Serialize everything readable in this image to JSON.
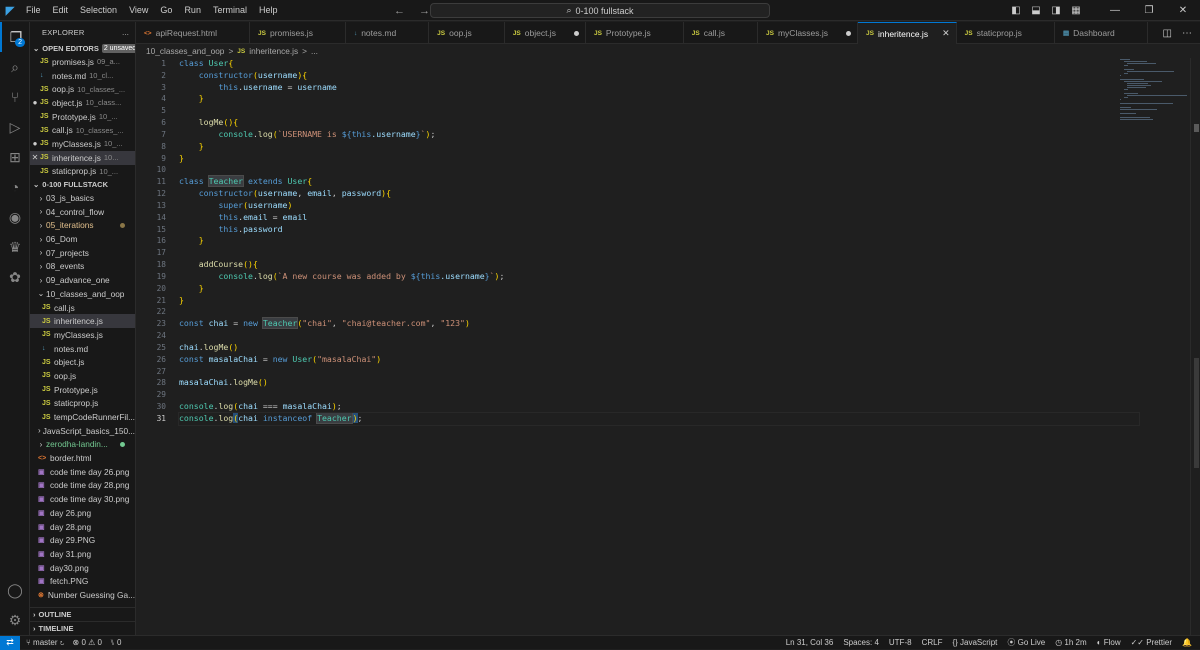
{
  "titlebar": {
    "menu": [
      "File",
      "Edit",
      "Selection",
      "View",
      "Go",
      "Run",
      "Terminal",
      "Help"
    ],
    "search": "0-100 fullstack"
  },
  "activity": {
    "source_control_badge": "2"
  },
  "explorer": {
    "title": "EXPLORER",
    "more": "...",
    "open_editors_label": "OPEN EDITORS",
    "unsaved_label": "2 unsaved",
    "open_editors": [
      {
        "name": "promises.js",
        "path": "09_a...",
        "icon": "JS"
      },
      {
        "name": "notes.md",
        "path": "10_cl...",
        "icon": "↓"
      },
      {
        "name": "oop.js",
        "path": "10_classes_...",
        "icon": "JS"
      },
      {
        "name": "object.js",
        "path": "10_class...",
        "icon": "JS",
        "mark": "●"
      },
      {
        "name": "Prototype.js",
        "path": "10_...",
        "icon": "JS"
      },
      {
        "name": "call.js",
        "path": "10_classes_...",
        "icon": "JS"
      },
      {
        "name": "myClasses.js",
        "path": "10_...",
        "icon": "JS",
        "mark": "●"
      },
      {
        "name": "inheritence.js",
        "path": "10...",
        "icon": "JS",
        "mark": "✕"
      },
      {
        "name": "staticprop.js",
        "path": "10_...",
        "icon": "JS"
      }
    ],
    "workspace_label": "0-100 FULLSTACK",
    "folders_top": [
      "03_js_basics",
      "04_control_flow",
      "05_iterations",
      "06_Dom",
      "07_projects",
      "08_events",
      "09_advance_one",
      "10_classes_and_oop"
    ],
    "folder_files": [
      {
        "name": "call.js",
        "icon": "JS"
      },
      {
        "name": "inheritence.js",
        "icon": "JS"
      },
      {
        "name": "myClasses.js",
        "icon": "JS"
      },
      {
        "name": "notes.md",
        "icon": "↓"
      },
      {
        "name": "object.js",
        "icon": "JS"
      },
      {
        "name": "oop.js",
        "icon": "JS"
      },
      {
        "name": "Prototype.js",
        "icon": "JS"
      },
      {
        "name": "staticprop.js",
        "icon": "JS"
      },
      {
        "name": "tempCodeRunnerFil...",
        "icon": "JS"
      }
    ],
    "folders_bottom": [
      "JavaScript_basics_150...",
      "zerodha-landin..."
    ],
    "root_files": [
      {
        "name": "border.html",
        "icon": "<>"
      },
      {
        "name": "code time day 26.png",
        "icon": "▣"
      },
      {
        "name": "code time day 28.png",
        "icon": "▣"
      },
      {
        "name": "code time day 30.png",
        "icon": "▣"
      },
      {
        "name": "day 26.png",
        "icon": "▣"
      },
      {
        "name": "day 28.png",
        "icon": "▣"
      },
      {
        "name": "day 29.PNG",
        "icon": "▣"
      },
      {
        "name": "day 31.png",
        "icon": "▣"
      },
      {
        "name": "day30.png",
        "icon": "▣"
      },
      {
        "name": "fetch.PNG",
        "icon": "▣"
      },
      {
        "name": "Number Guessing Ga...",
        "icon": "⊗"
      }
    ],
    "outline_label": "OUTLINE",
    "timeline_label": "TIMELINE"
  },
  "tabs": [
    {
      "name": "apiRequest.html",
      "icon": "<>"
    },
    {
      "name": "promises.js",
      "icon": "JS"
    },
    {
      "name": "notes.md",
      "icon": "↓"
    },
    {
      "name": "oop.js",
      "icon": "JS"
    },
    {
      "name": "object.js",
      "icon": "JS",
      "dirty": true
    },
    {
      "name": "Prototype.js",
      "icon": "JS"
    },
    {
      "name": "call.js",
      "icon": "JS"
    },
    {
      "name": "myClasses.js",
      "icon": "JS",
      "dirty": true
    },
    {
      "name": "inheritence.js",
      "icon": "JS",
      "active": true,
      "close": "✕"
    },
    {
      "name": "staticprop.js",
      "icon": "JS"
    },
    {
      "name": "Dashboard",
      "icon": "▤"
    }
  ],
  "breadcrumb": {
    "folder": "10_classes_and_oop",
    "sep": ">",
    "file_icon": "JS",
    "file": "inheritence.js",
    "tail": "..."
  },
  "code_lines": [
    "class User{",
    "    constructor(username){",
    "        this.username = username",
    "    }",
    "",
    "    logMe(){",
    "        console.log(`USERNAME is ${this.username}`);",
    "    }",
    "}",
    "",
    "class Teacher extends User{",
    "    constructor(username, email, password){",
    "        super(username)",
    "        this.email = email",
    "        this.password",
    "    }",
    "",
    "    addCourse(){",
    "        console.log(`A new course was added by ${this.username}`);",
    "    }",
    "}",
    "",
    "const chai = new Teacher(\"chai\", \"chai@teacher.com\", \"123\")",
    "",
    "chai.logMe()",
    "const masalaChai = new User(\"masalaChai\")",
    "",
    "masalaChai.logMe()",
    "",
    "console.log(chai === masalaChai);",
    "console.log(chai instanceof Teacher);"
  ],
  "cursor_line": 31,
  "statusbar": {
    "branch": "master",
    "sync": "↻",
    "errors": "0",
    "warnings": "0",
    "ports": "0",
    "position": "Ln 31, Col 36",
    "spaces": "Spaces: 4",
    "encoding": "UTF-8",
    "eol": "CRLF",
    "language": "JavaScript",
    "golive": "Go Live",
    "time": "1h 2m",
    "flow": "Flow",
    "prettier": "Prettier"
  },
  "colors": {
    "accent": "#0078d4",
    "keyword": "#569cd6",
    "class": "#4ec9b0",
    "function": "#dcdcaa",
    "string": "#ce9178",
    "variable": "#9cdcfe"
  }
}
